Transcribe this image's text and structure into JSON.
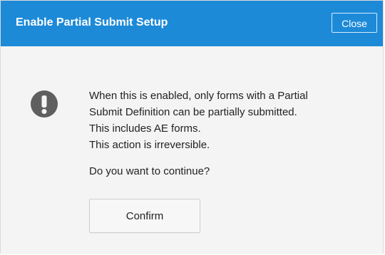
{
  "dialog": {
    "title": "Enable Partial Submit Setup",
    "close_label": "Close",
    "icon": "exclamation-icon",
    "message_lines": [
      "When this is enabled, only forms with a Partial",
      "Submit Definition can be partially submitted.",
      "This includes AE forms.",
      "This action is irreversible."
    ],
    "question": "Do you want to continue?",
    "confirm_label": "Confirm"
  },
  "colors": {
    "header_background": "#1d8ad8",
    "body_background": "#f4f4f4",
    "icon": "#5f5f5f",
    "text": "#222222"
  }
}
